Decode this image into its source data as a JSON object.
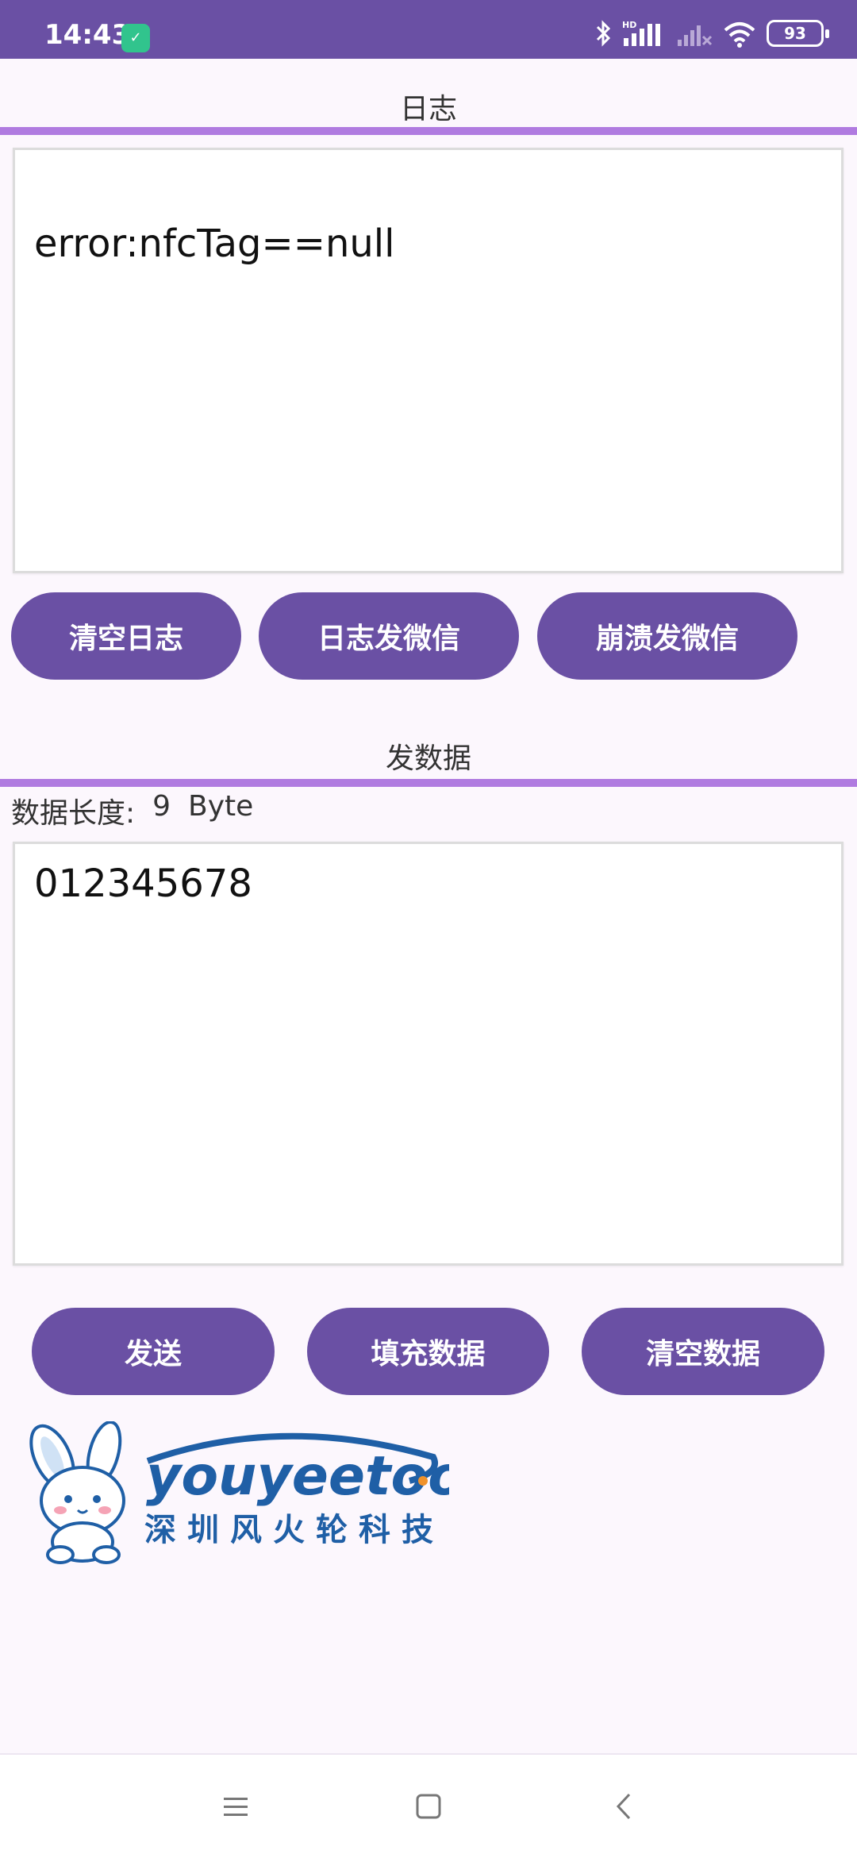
{
  "status_bar": {
    "time": "14:43",
    "network_label": "HD",
    "battery": "93"
  },
  "log_section": {
    "title": "日志",
    "log_content": "error:nfcTag==null",
    "buttons": {
      "clear_log": "清空日志",
      "send_log_wechat": "日志发微信",
      "send_crash_wechat": "崩溃发微信"
    }
  },
  "send_section": {
    "title": "发数据",
    "length_label": "数据长度:",
    "length_value": "9",
    "length_unit": "Byte",
    "data_value": "012345678",
    "buttons": {
      "send": "发送",
      "fill_data": "填充数据",
      "clear_data": "清空数据"
    }
  },
  "logo": {
    "brand": "youyeetoo",
    "company": "深圳风火轮科技"
  },
  "colors": {
    "primary": "#6a50a4",
    "divider": "#b07be0",
    "background": "#fcf7fd",
    "logo_blue": "#1f5fa6"
  },
  "nav_icons": [
    "menu-icon",
    "home-icon",
    "back-icon"
  ]
}
